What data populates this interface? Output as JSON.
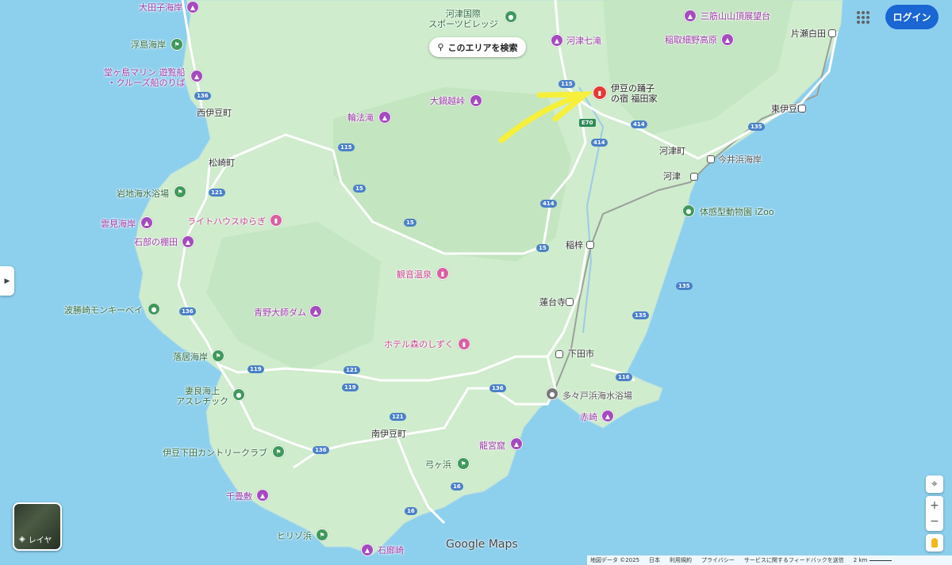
{
  "search_area": {
    "label": "このエリアを検索"
  },
  "header": {
    "login_label": "ログイン"
  },
  "annotation": {
    "arrow_color": "#f7f03a"
  },
  "highlight": {
    "label_line1": "伊豆の踊子",
    "label_line2": "の宿 福田家"
  },
  "pois": {
    "kawazu_kokusai_1": "河津国際",
    "kawazu_kokusai_2": "スポーツビレッジ",
    "kawazu_nanadaru": "河津七滝",
    "mitsusujiyama": "三筋山山頂展望台",
    "inatori_hosono": "稲取細野高原",
    "ohnabe": "大鍋越峠",
    "rinpodaki": "輪法滝",
    "ootago": "大田子海岸",
    "ukishima": "浮島海岸",
    "dogashima_1": "堂ヶ島マリン 遊覧船",
    "dogashima_2": "・クルーズ船のりば",
    "iwachi": "岩地海水浴場",
    "kumomi": "雲見海岸",
    "ishibu": "石部の棚田",
    "lighthouse_yuragi": "ライトハウスゆらぎ",
    "kannon_onsen": "観音温泉",
    "hasamisaki": "波勝崎モンキーベイ",
    "aono_daishi": "青野大師ダム",
    "hotel_mori": "ホテル森のしずく",
    "ochii": "落居海岸",
    "mera_1": "妻良海上",
    "mera_2": "アスレチック",
    "tataido": "多々戸浜海水浴場",
    "akane": "赤崎",
    "izu_country": "伊豆下田カントリークラブ",
    "ryugukutsu": "龍宮窟",
    "yuminohama": "弓ヶ浜",
    "senjojiki": "千畳敷",
    "hirizo": "ヒリゾ浜",
    "irozaki": "石廊崎",
    "izoo": "体感型動物園 iZoo",
    "imaihama": "今井浜海岸"
  },
  "towns": {
    "nishiizu": "西伊豆町",
    "matsuzaki": "松崎町",
    "kawazu_town": "河津町",
    "kawazu_sta": "河津",
    "higashiizu": "東伊豆町",
    "katasehirata": "片瀬白田",
    "inazusa": "稲梓",
    "rendaiji": "蓮台寺",
    "shimoda": "下田市",
    "minamiizu": "南伊豆町"
  },
  "roads": [
    "115",
    "15",
    "121",
    "136",
    "119",
    "414",
    "135",
    "116",
    "16",
    "E70"
  ],
  "map_colors": {
    "land": "#cfeccd",
    "sea": "#8dd0ee",
    "road": "#ffffff",
    "rail": "#9aa09a"
  },
  "branding": {
    "logo": "Google Maps"
  },
  "layers": {
    "label": "レイヤ"
  },
  "controls": {
    "locate_icon": "⌖",
    "zoom_in": "+",
    "zoom_out": "−",
    "pegman_icon": "pegman"
  },
  "footer": {
    "map_data": "地図データ ©2025",
    "country": "日本",
    "terms": "利用規約",
    "privacy": "プライバシー",
    "feedback": "サービスに関するフィードバックを送信",
    "scale": "2 km"
  }
}
